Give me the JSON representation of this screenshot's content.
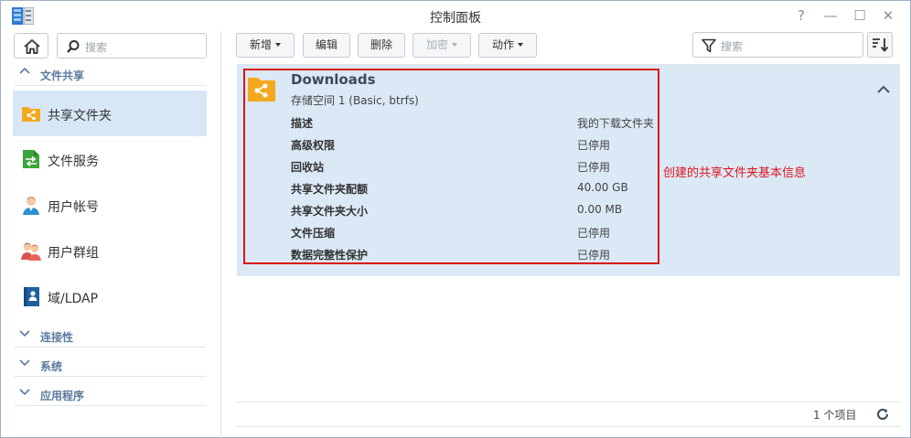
{
  "window": {
    "title": "控制面板",
    "controls": [
      "?",
      "—",
      "☐",
      "✕"
    ]
  },
  "sidebar": {
    "search_placeholder": "搜索",
    "section_file_sharing": "文件共享",
    "items": [
      {
        "label": "共享文件夹",
        "icon": "shared-folder-icon",
        "active": true
      },
      {
        "label": "文件服务",
        "icon": "file-services-icon"
      },
      {
        "label": "用户帐号",
        "icon": "user-icon"
      },
      {
        "label": "用户群组",
        "icon": "group-icon"
      },
      {
        "label": "域/LDAP",
        "icon": "domain-ldap-icon"
      }
    ],
    "sections_collapsed": [
      "连接性",
      "系统",
      "应用程序"
    ]
  },
  "toolbar": {
    "create": "新增",
    "edit": "编辑",
    "delete": "删除",
    "encrypt": "加密",
    "action": "动作",
    "search_placeholder": "搜索"
  },
  "folder": {
    "name": "Downloads",
    "volume": "存储空间 1 (Basic, btrfs)",
    "details": [
      {
        "label": "描述",
        "value": "我的下载文件夹"
      },
      {
        "label": "高级权限",
        "value": "已停用"
      },
      {
        "label": "回收站",
        "value": "已停用"
      },
      {
        "label": "共享文件夹配额",
        "value": "40.00 GB"
      },
      {
        "label": "共享文件夹大小",
        "value": "0.00 MB"
      },
      {
        "label": "文件压缩",
        "value": "已停用"
      },
      {
        "label": "数据完整性保护",
        "value": "已停用"
      }
    ]
  },
  "annotation": "创建的共享文件夹基本信息",
  "footer": {
    "item_count": "1 个项目"
  },
  "colors": {
    "selected_row": "#dbe8f6",
    "highlight_box": "#d9131b",
    "folder_orange": "#f4a81d"
  }
}
